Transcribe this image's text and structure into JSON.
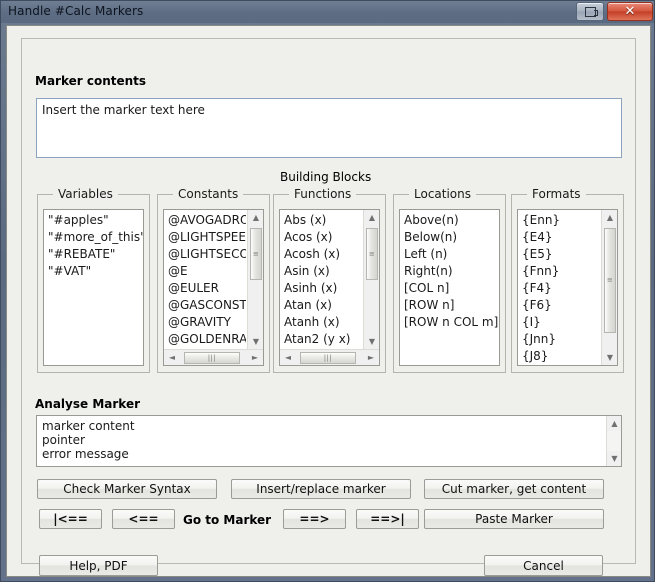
{
  "window": {
    "title": "Handle #Calc Markers",
    "buttons": {
      "restore_icon": "restore-icon",
      "close_label": "✕"
    }
  },
  "marker_contents": {
    "label": "Marker contents",
    "text": "Insert the marker text here"
  },
  "building_blocks": {
    "label": "Building Blocks",
    "groups": [
      {
        "title": "Variables",
        "items": [
          "\"#apples\"",
          "\"#more_of_this\"",
          "\"#REBATE\"",
          "\"#VAT\""
        ],
        "vscroll": false,
        "hscroll": false
      },
      {
        "title": "Constants",
        "items": [
          "@AVOGADRO",
          "@LIGHTSPEED",
          "@LIGHTSECON",
          "@E",
          "@EULER",
          "@GASCONST",
          "@GRAVITY",
          "@GOLDENRATI"
        ],
        "vscroll": true,
        "hscroll": true
      },
      {
        "title": "Functions",
        "items": [
          "Abs (x)",
          "Acos (x)",
          "Acosh (x)",
          "Asin (x)",
          "Asinh (x)",
          "Atan (x)",
          "Atanh (x)",
          "Atan2 (y x)"
        ],
        "vscroll": true,
        "hscroll": true
      },
      {
        "title": "Locations",
        "items": [
          "Above(n)",
          "Below(n)",
          "Left (n)",
          "Right(n)",
          "[COL n]",
          "[ROW n]",
          "[ROW n COL m]"
        ],
        "vscroll": false,
        "hscroll": false
      },
      {
        "title": "Formats",
        "items": [
          "{Enn}",
          "{E4}",
          "{E5}",
          "{Fnn}",
          "{F4}",
          "{F6}",
          "{I}",
          "{Jnn}",
          "{J8}"
        ],
        "vscroll": true,
        "hscroll": false
      }
    ]
  },
  "analyse_marker": {
    "label": "Analyse Marker",
    "lines": [
      "marker content",
      "pointer",
      "error message"
    ]
  },
  "actions": {
    "check_syntax": "Check Marker Syntax",
    "insert_replace": "Insert/replace marker",
    "cut_marker": "Cut marker, get content",
    "first": "|<==",
    "prev": "<==",
    "goto_label": "Go to Marker",
    "next": "==>",
    "last": "==>|",
    "paste_marker": "Paste Marker",
    "help_pdf": "Help, PDF",
    "cancel": "Cancel"
  },
  "scroll_glyphs": {
    "up": "▲",
    "down": "▼",
    "left": "◄",
    "right": "►",
    "grip": "|||"
  }
}
